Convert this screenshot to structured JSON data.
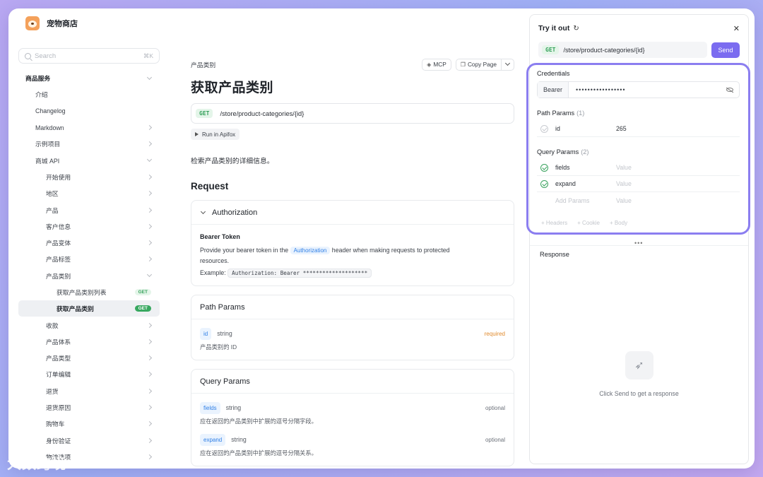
{
  "app": {
    "title": "宠物商店"
  },
  "sidebar": {
    "search_placeholder": "Search",
    "search_shortcut": "⌘K",
    "items": [
      {
        "label": "商品服务",
        "level": 0,
        "chevron": "down"
      },
      {
        "label": "介绍",
        "level": 1
      },
      {
        "label": "Changelog",
        "level": 1
      },
      {
        "label": "Markdown",
        "level": 1,
        "chevron": "right"
      },
      {
        "label": "示例项目",
        "level": 1,
        "chevron": "right"
      },
      {
        "label": "商城 API",
        "level": 1,
        "chevron": "down"
      },
      {
        "label": "开始使用",
        "level": 2,
        "chevron": "right"
      },
      {
        "label": "地区",
        "level": 2,
        "chevron": "right"
      },
      {
        "label": "产品",
        "level": 2,
        "chevron": "right"
      },
      {
        "label": "客户信息",
        "level": 2,
        "chevron": "right"
      },
      {
        "label": "产品变体",
        "level": 2,
        "chevron": "right"
      },
      {
        "label": "产品标签",
        "level": 2,
        "chevron": "right"
      },
      {
        "label": "产品类别",
        "level": 2,
        "chevron": "down"
      },
      {
        "label": "获取产品类别列表",
        "level": 3,
        "badge": "GET"
      },
      {
        "label": "获取产品类别",
        "level": 3,
        "badge": "GET",
        "active": true
      },
      {
        "label": "收款",
        "level": 2,
        "chevron": "right"
      },
      {
        "label": "产品体系",
        "level": 2,
        "chevron": "right"
      },
      {
        "label": "产品类型",
        "level": 2,
        "chevron": "right"
      },
      {
        "label": "订单编辑",
        "level": 2,
        "chevron": "right"
      },
      {
        "label": "退货",
        "level": 2,
        "chevron": "right"
      },
      {
        "label": "退货原因",
        "level": 2,
        "chevron": "right"
      },
      {
        "label": "购物车",
        "level": 2,
        "chevron": "right"
      },
      {
        "label": "身份验证",
        "level": 2,
        "chevron": "right"
      },
      {
        "label": "物流选项",
        "level": 2,
        "chevron": "right"
      }
    ]
  },
  "main": {
    "breadcrumb": "产品类别",
    "mcp_label": "MCP",
    "copy_label": "Copy Page",
    "title": "获取产品类别",
    "method": "GET",
    "path": "/store/product-categories/{id}",
    "run_label": "Run in Apifox",
    "description": "检索产品类别的详细信息。",
    "request_heading": "Request",
    "auth": {
      "heading": "Authorization",
      "token_title": "Bearer Token",
      "text_before": "Provide your bearer token in the",
      "header_tag": "Authorization",
      "text_after": "header when making requests to protected",
      "text_line2": "resources.",
      "example_label": "Example:",
      "example_code": "Authorization: Bearer ********************"
    },
    "path_params": {
      "heading": "Path Params",
      "items": [
        {
          "name": "id",
          "type": "string",
          "flag": "required",
          "desc": "产品类别的 ID"
        }
      ]
    },
    "query_params": {
      "heading": "Query Params",
      "items": [
        {
          "name": "fields",
          "type": "string",
          "flag": "optional",
          "desc": "应在返回的产品类别中扩展的逗号分隔字段。"
        },
        {
          "name": "expand",
          "type": "string",
          "flag": "optional",
          "desc": "应在返回的产品类别中扩展的逗号分隔关系。"
        }
      ]
    }
  },
  "panel": {
    "title": "Try it out",
    "method": "GET",
    "url": "/store/product-categories/{id}",
    "send_label": "Send",
    "credentials_label": "Credentials",
    "bearer_label": "Bearer",
    "bearer_value": "•••••••••••••••••",
    "path_params_label": "Path Params",
    "path_params_count": "(1)",
    "path_params": [
      {
        "name": "id",
        "value": "265",
        "enabled": false
      }
    ],
    "query_params_label": "Query Params",
    "query_params_count": "(2)",
    "query_params": [
      {
        "name": "fields",
        "value": "Value",
        "enabled": true
      },
      {
        "name": "expand",
        "value": "Value",
        "enabled": true
      }
    ],
    "add_params_placeholder": "Add Params",
    "add_value_placeholder": "Value",
    "extras": [
      "+ Headers",
      "+ Cookie",
      "+ Body"
    ],
    "response_label": "Response",
    "response_hint": "Click Send to get a response"
  },
  "watermark": "大数跨境",
  "colors": {
    "accent": "#7b6cf0",
    "get": "#34a05a",
    "required": "#e08a2d",
    "highlight": "#8b7ef0"
  }
}
